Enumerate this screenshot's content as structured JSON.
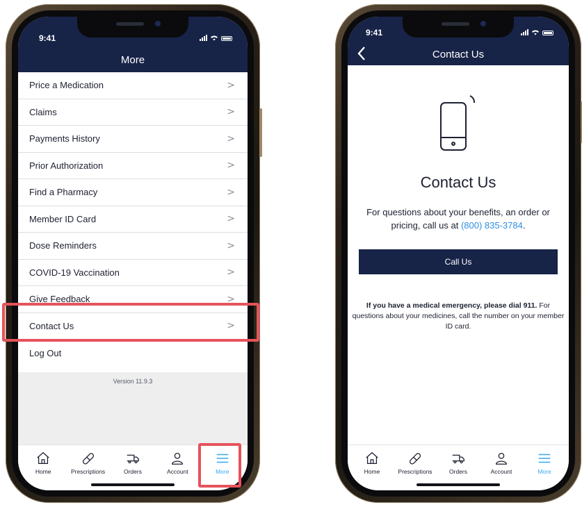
{
  "status_time": "9:41",
  "more_screen": {
    "title": "More",
    "menu_items": [
      {
        "label": "Price a Medication"
      },
      {
        "label": "Claims"
      },
      {
        "label": "Payments History"
      },
      {
        "label": "Prior Authorization"
      },
      {
        "label": "Find a Pharmacy"
      },
      {
        "label": "Member ID Card"
      },
      {
        "label": "Dose Reminders"
      },
      {
        "label": "COVID-19 Vaccination"
      },
      {
        "label": "Give Feedback"
      },
      {
        "label": "Contact Us"
      }
    ],
    "chevron": ">",
    "logout_label": "Log Out",
    "version": "Version 11.9.3"
  },
  "contact_screen": {
    "title": "Contact Us",
    "heading": "Contact Us",
    "text_before": "For questions about your benefits, an order or pricing, call us at ",
    "phone": "(800) 835-3784",
    "text_after": ".",
    "call_button": "Call Us",
    "emergency_bold": "If you have a medical emergency, please dial 911.",
    "emergency_rest": "For questions about your medicines, call the number on your member ID card."
  },
  "tabs": [
    {
      "label": "Home",
      "icon": "home-icon"
    },
    {
      "label": "Prescriptions",
      "icon": "pill-icon"
    },
    {
      "label": "Orders",
      "icon": "truck-icon"
    },
    {
      "label": "Account",
      "icon": "person-icon"
    },
    {
      "label": "More",
      "icon": "menu-icon",
      "active": true
    }
  ],
  "colors": {
    "header": "#172347",
    "accent": "#36a8f0",
    "link": "#2e8fe0",
    "highlight": "#e5535b"
  }
}
